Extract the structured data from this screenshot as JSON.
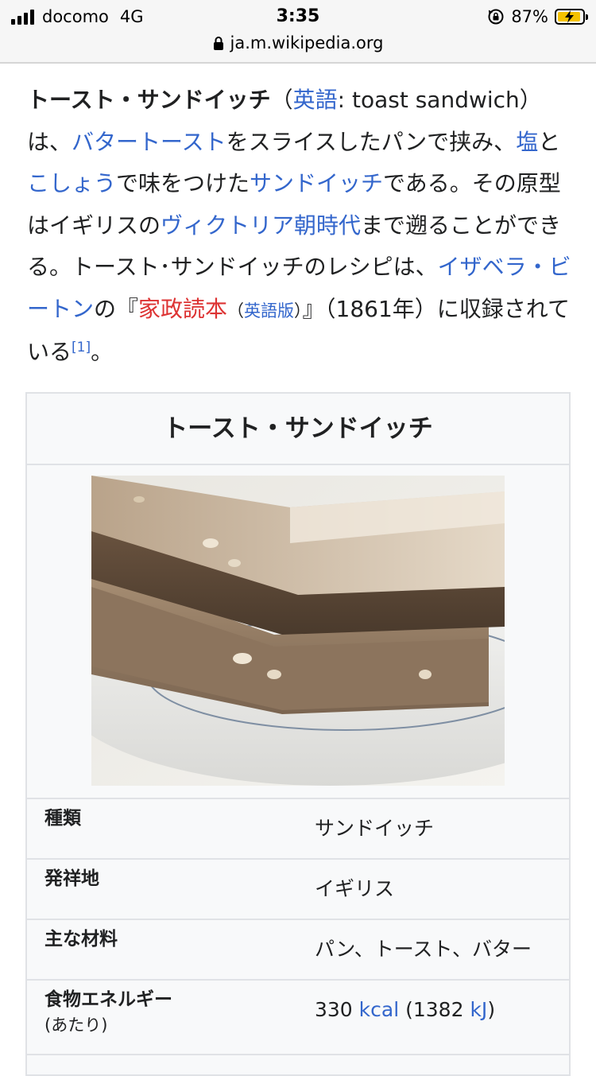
{
  "status_bar": {
    "carrier": "docomo",
    "network": "4G",
    "time": "3:35",
    "battery": "87%",
    "url": "ja.m.wikipedia.org",
    "signal_icon": "signal-bars-icon",
    "rotation_lock_icon": "rotation-lock-icon",
    "battery_icon": "battery-charging-icon",
    "padlock_icon": "padlock-icon"
  },
  "article": {
    "term": "トースト・サンドイッチ",
    "paren_open": "（",
    "lang_link": "英語",
    "lang_text": ": toast sandwich）",
    "t1": "は、",
    "link_butter_toast": "バタートースト",
    "t2": "をスライスしたパンで挟み、",
    "link_salt": "塩",
    "t3": "と",
    "link_pepper": "こしょう",
    "t4": "で味をつけた",
    "link_sandwich": "サンドイッチ",
    "t5": "である。その原型はイギリスの",
    "link_victorian": "ヴィクトリア朝時代",
    "t6": "まで遡ることができる。トースト･サンドイッチのレシピは、",
    "link_beeton": "イザベラ・ビートン",
    "t7": "の『",
    "link_book": "家政読本",
    "lang_version_open": "（",
    "lang_version_link": "英語版",
    "lang_version_close": "）",
    "t8": "』（1861年）に収録されている",
    "ref": "[1]",
    "t9": "。"
  },
  "infobox": {
    "title": "トースト・サンドイッチ",
    "image_alt": "toast-sandwich-photo",
    "rows": [
      {
        "label": "種類",
        "value": "サンドイッチ",
        "value_is_link": true
      },
      {
        "label": "発祥地",
        "value": "イギリス",
        "value_is_link": false
      },
      {
        "label": "主な材料",
        "value": "パン、トースト、バター",
        "value_is_link": true
      },
      {
        "label": "食物エネルギー",
        "sublabel": "(あたり)",
        "value_parts": [
          "330 ",
          "kcal",
          " (1382 ",
          "kJ",
          ")"
        ]
      }
    ]
  },
  "colors": {
    "link": "#3366cc",
    "new_link": "#dd3333",
    "text": "#202122",
    "infobox_bg": "#f8f9fa"
  }
}
